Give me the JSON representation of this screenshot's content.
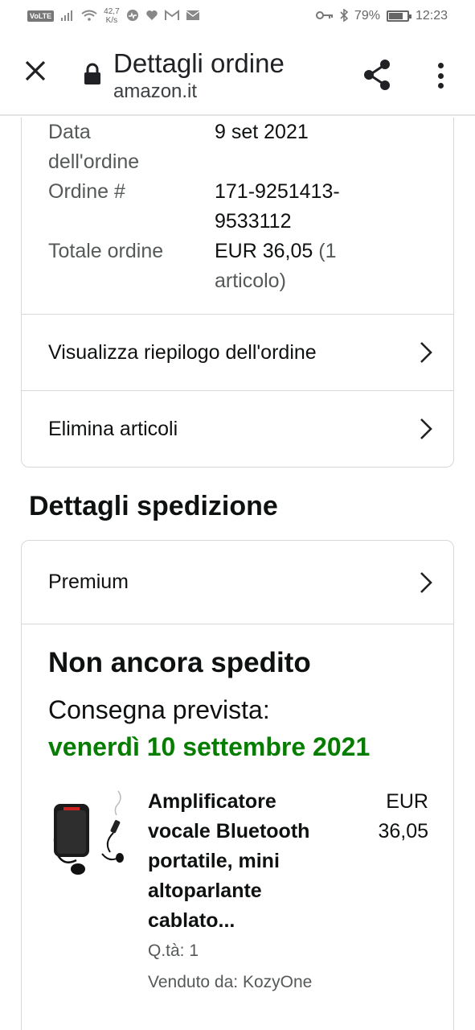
{
  "status_bar": {
    "volte": "VoLTE",
    "speed_value": "42,7",
    "speed_unit": "K/s",
    "battery_percent": "79%",
    "battery_level": 0.79,
    "time": "12:23"
  },
  "header": {
    "title": "Dettagli ordine",
    "domain": "amazon.it"
  },
  "order_info": {
    "date_label_line1": "Data",
    "date_label_line2": "dell'ordine",
    "date_value": "9 set 2021",
    "order_label": "Ordine #",
    "order_number_line1": "171-9251413-",
    "order_number_line2": "9533112",
    "total_label": "Totale ordine",
    "total_amount": "EUR 36,05",
    "total_items_line1": "(1",
    "total_items_line2": "articolo)"
  },
  "actions": {
    "view_summary": "Visualizza riepilogo dell'ordine",
    "delete_items": "Elimina articoli"
  },
  "shipping": {
    "section_title": "Dettagli spedizione",
    "shipping_speed": "Premium",
    "status": "Non ancora spedito",
    "delivery_label": "Consegna prevista:",
    "delivery_date": "venerdì 10 settembre 2021",
    "delivery_color": "#067d00"
  },
  "item": {
    "title_lines": [
      "Amplificatore",
      "vocale Bluetooth",
      "portatile, mini",
      "altoparlante",
      "cablato..."
    ],
    "price_currency": "EUR",
    "price_value": "36,05",
    "quantity": "Q.tà: 1",
    "seller": "Venduto da: KozyOne"
  },
  "icons": {
    "close": "close-icon",
    "lock": "lock-icon",
    "share": "share-icon",
    "more": "more-vert-icon",
    "chevron": "chevron-right-icon"
  }
}
